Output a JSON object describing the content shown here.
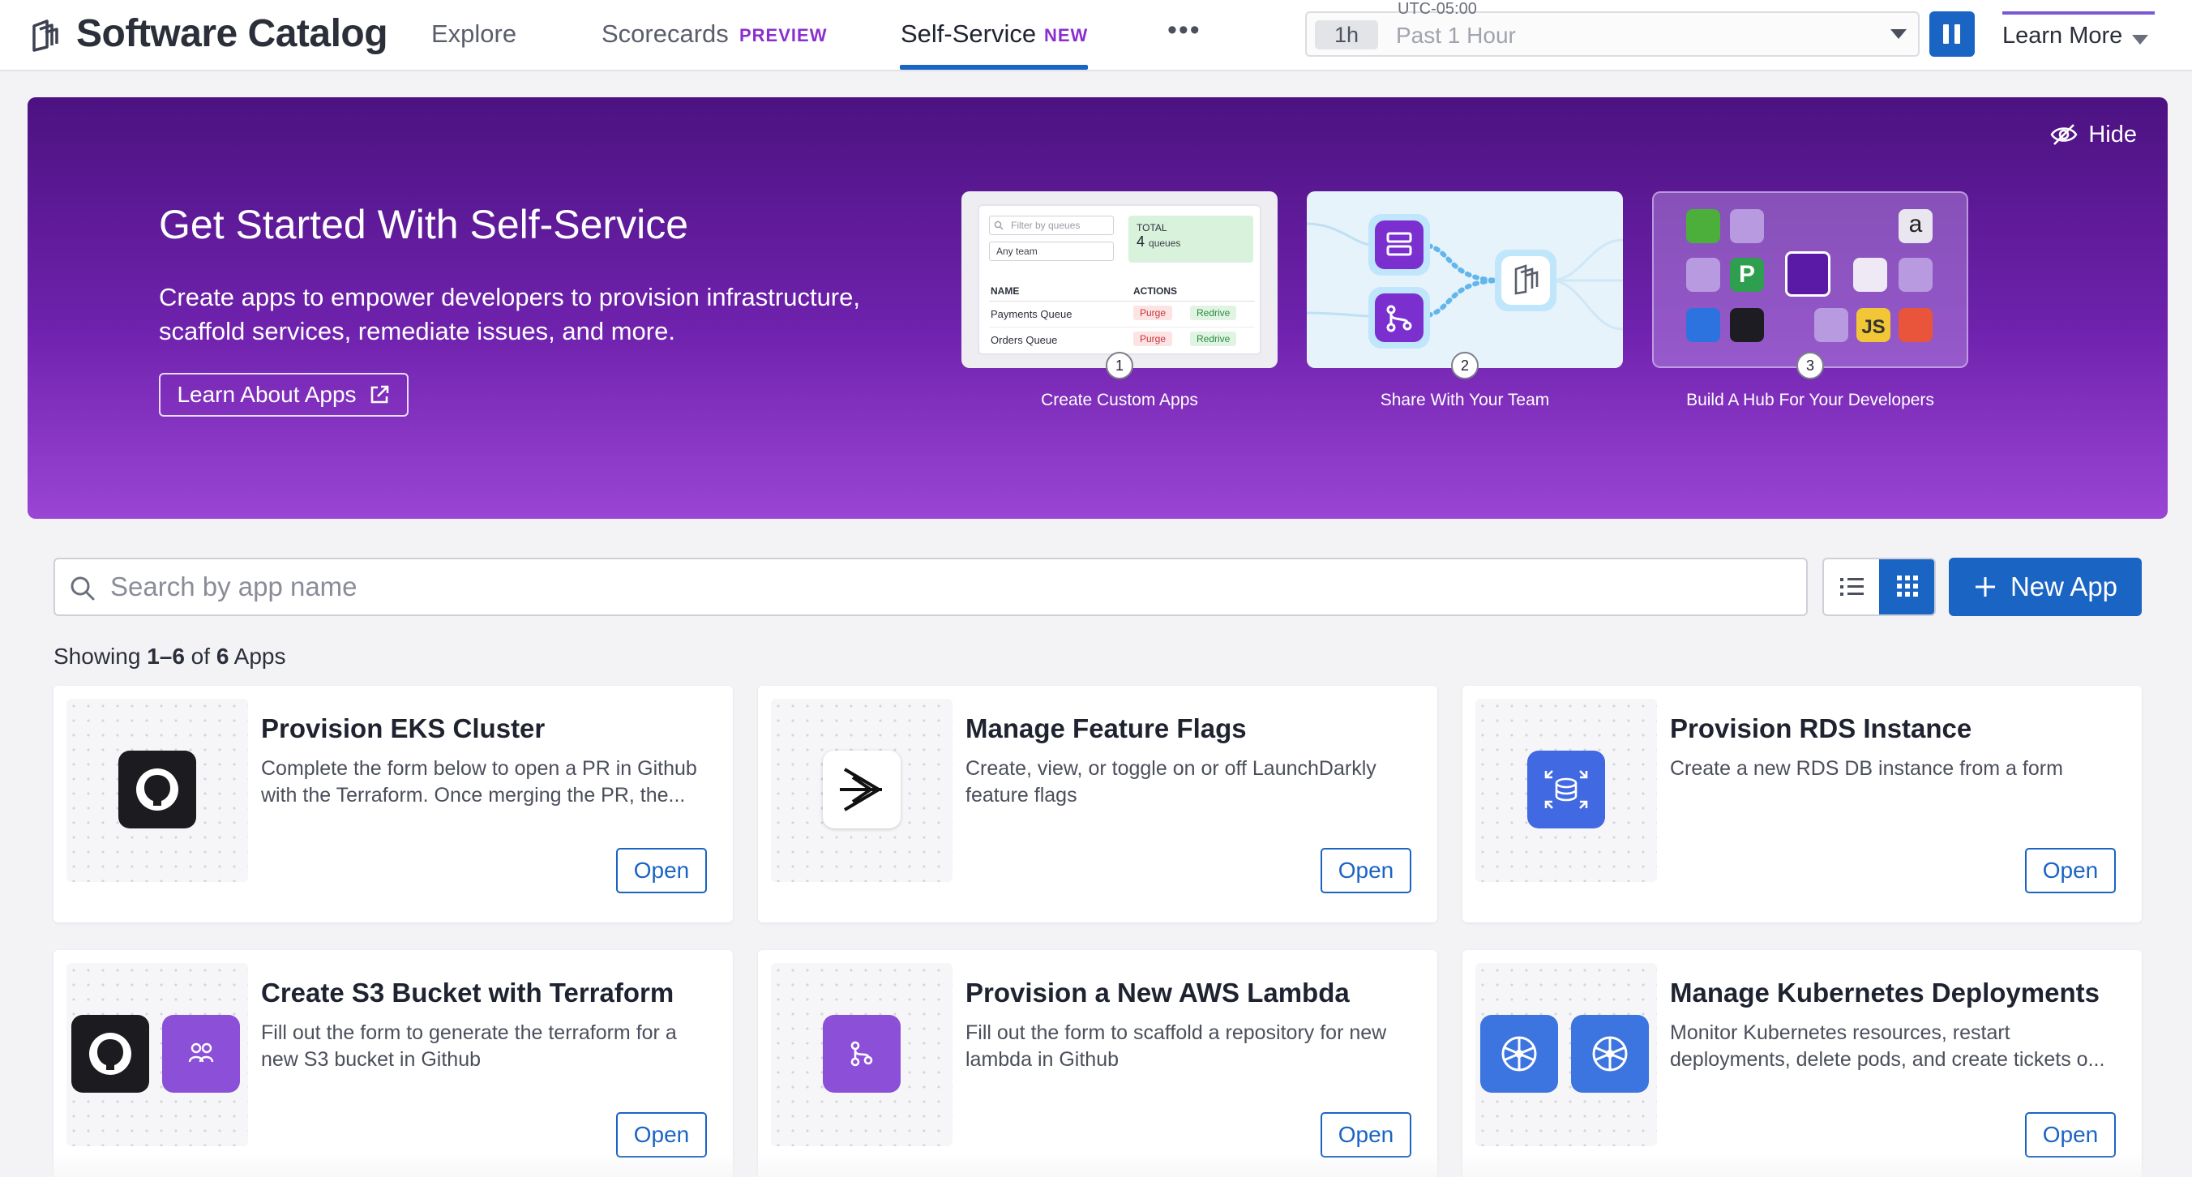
{
  "header": {
    "app_title": "Software Catalog",
    "nav": [
      {
        "label": "Explore",
        "badge": ""
      },
      {
        "label": "Scorecards",
        "badge": "PREVIEW"
      },
      {
        "label": "Self-Service",
        "badge": "NEW"
      }
    ],
    "more_label": "•••",
    "timezone": "UTC-05:00",
    "time_chip": "1h",
    "time_label": "Past 1 Hour",
    "learn_more": "Learn More",
    "colors": {
      "accent": "#1a64c4",
      "badge": "#8a2fcf"
    }
  },
  "hero": {
    "hide_label": "Hide",
    "title": "Get Started With Self-Service",
    "description": "Create apps to empower developers to provision infrastructure, scaffold services, remediate issues, and more.",
    "button_label": "Learn About Apps",
    "steps": [
      {
        "number": "1",
        "label": "Create Custom Apps"
      },
      {
        "number": "2",
        "label": "Share With Your Team"
      },
      {
        "number": "3",
        "label": "Build A Hub For Your Developers"
      }
    ],
    "preview_table": {
      "filter_placeholder": "Filter by queues",
      "team_select": "Any team",
      "total_label": "TOTAL",
      "total_count": "4",
      "total_unit": "queues",
      "col_name": "NAME",
      "col_actions": "ACTIONS",
      "rows": [
        {
          "name": "Payments Queue",
          "purge": "Purge",
          "redrive": "Redrive"
        },
        {
          "name": "Orders Queue",
          "purge": "Purge",
          "redrive": "Redrive"
        }
      ]
    },
    "hub_tile_text": {
      "p": "P",
      "a": "a",
      "js": "JS"
    }
  },
  "toolbar": {
    "search_placeholder": "Search by app name",
    "new_app_label": "New App"
  },
  "results": {
    "prefix": "Showing ",
    "range": "1–6",
    "middle": " of ",
    "total": "6",
    "suffix": " Apps"
  },
  "apps": [
    {
      "title": "Provision EKS Cluster",
      "description": "Complete the form below to open a PR in Github with the Terraform. Once merging the PR, the...",
      "open_label": "Open",
      "icons": [
        "github-icon"
      ]
    },
    {
      "title": "Manage Feature Flags",
      "description": "Create, view, or toggle on or off LaunchDarkly feature flags",
      "open_label": "Open",
      "icons": [
        "launchdarkly-icon"
      ]
    },
    {
      "title": "Provision RDS Instance",
      "description": "Create a new RDS DB instance from a form",
      "open_label": "Open",
      "icons": [
        "rds-icon"
      ]
    },
    {
      "title": "Create S3 Bucket with Terraform",
      "description": "Fill out the form to generate the terraform for a new S3 bucket in Github",
      "open_label": "Open",
      "icons": [
        "github-icon",
        "team-icon"
      ]
    },
    {
      "title": "Provision a New AWS Lambda",
      "description": "Fill out the form to scaffold a repository for new lambda in Github",
      "open_label": "Open",
      "icons": [
        "git-branch-icon"
      ]
    },
    {
      "title": "Manage Kubernetes Deployments",
      "description": "Monitor Kubernetes resources, restart deployments, delete pods, and create tickets o...",
      "open_label": "Open",
      "icons": [
        "kubernetes-icon",
        "kubernetes-icon"
      ]
    }
  ]
}
